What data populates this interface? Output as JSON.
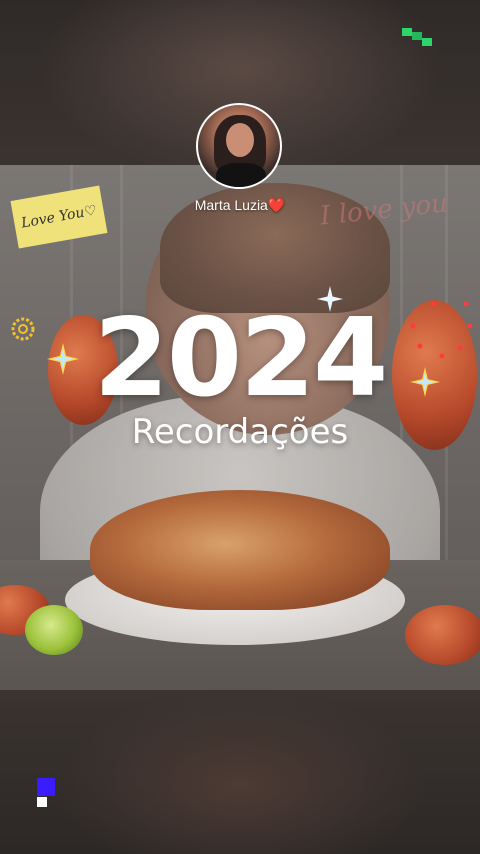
{
  "profile": {
    "name": "Marta Luzia",
    "heart_icon": "❤️"
  },
  "story": {
    "year": "2024",
    "subtitle": "Recordações"
  },
  "photo": {
    "note_text": "Love You♡",
    "wall_text": "I love you"
  },
  "colors": {
    "accent_green": "#2bd66b",
    "accent_blue": "#3b1cff",
    "text": "#ffffff"
  }
}
